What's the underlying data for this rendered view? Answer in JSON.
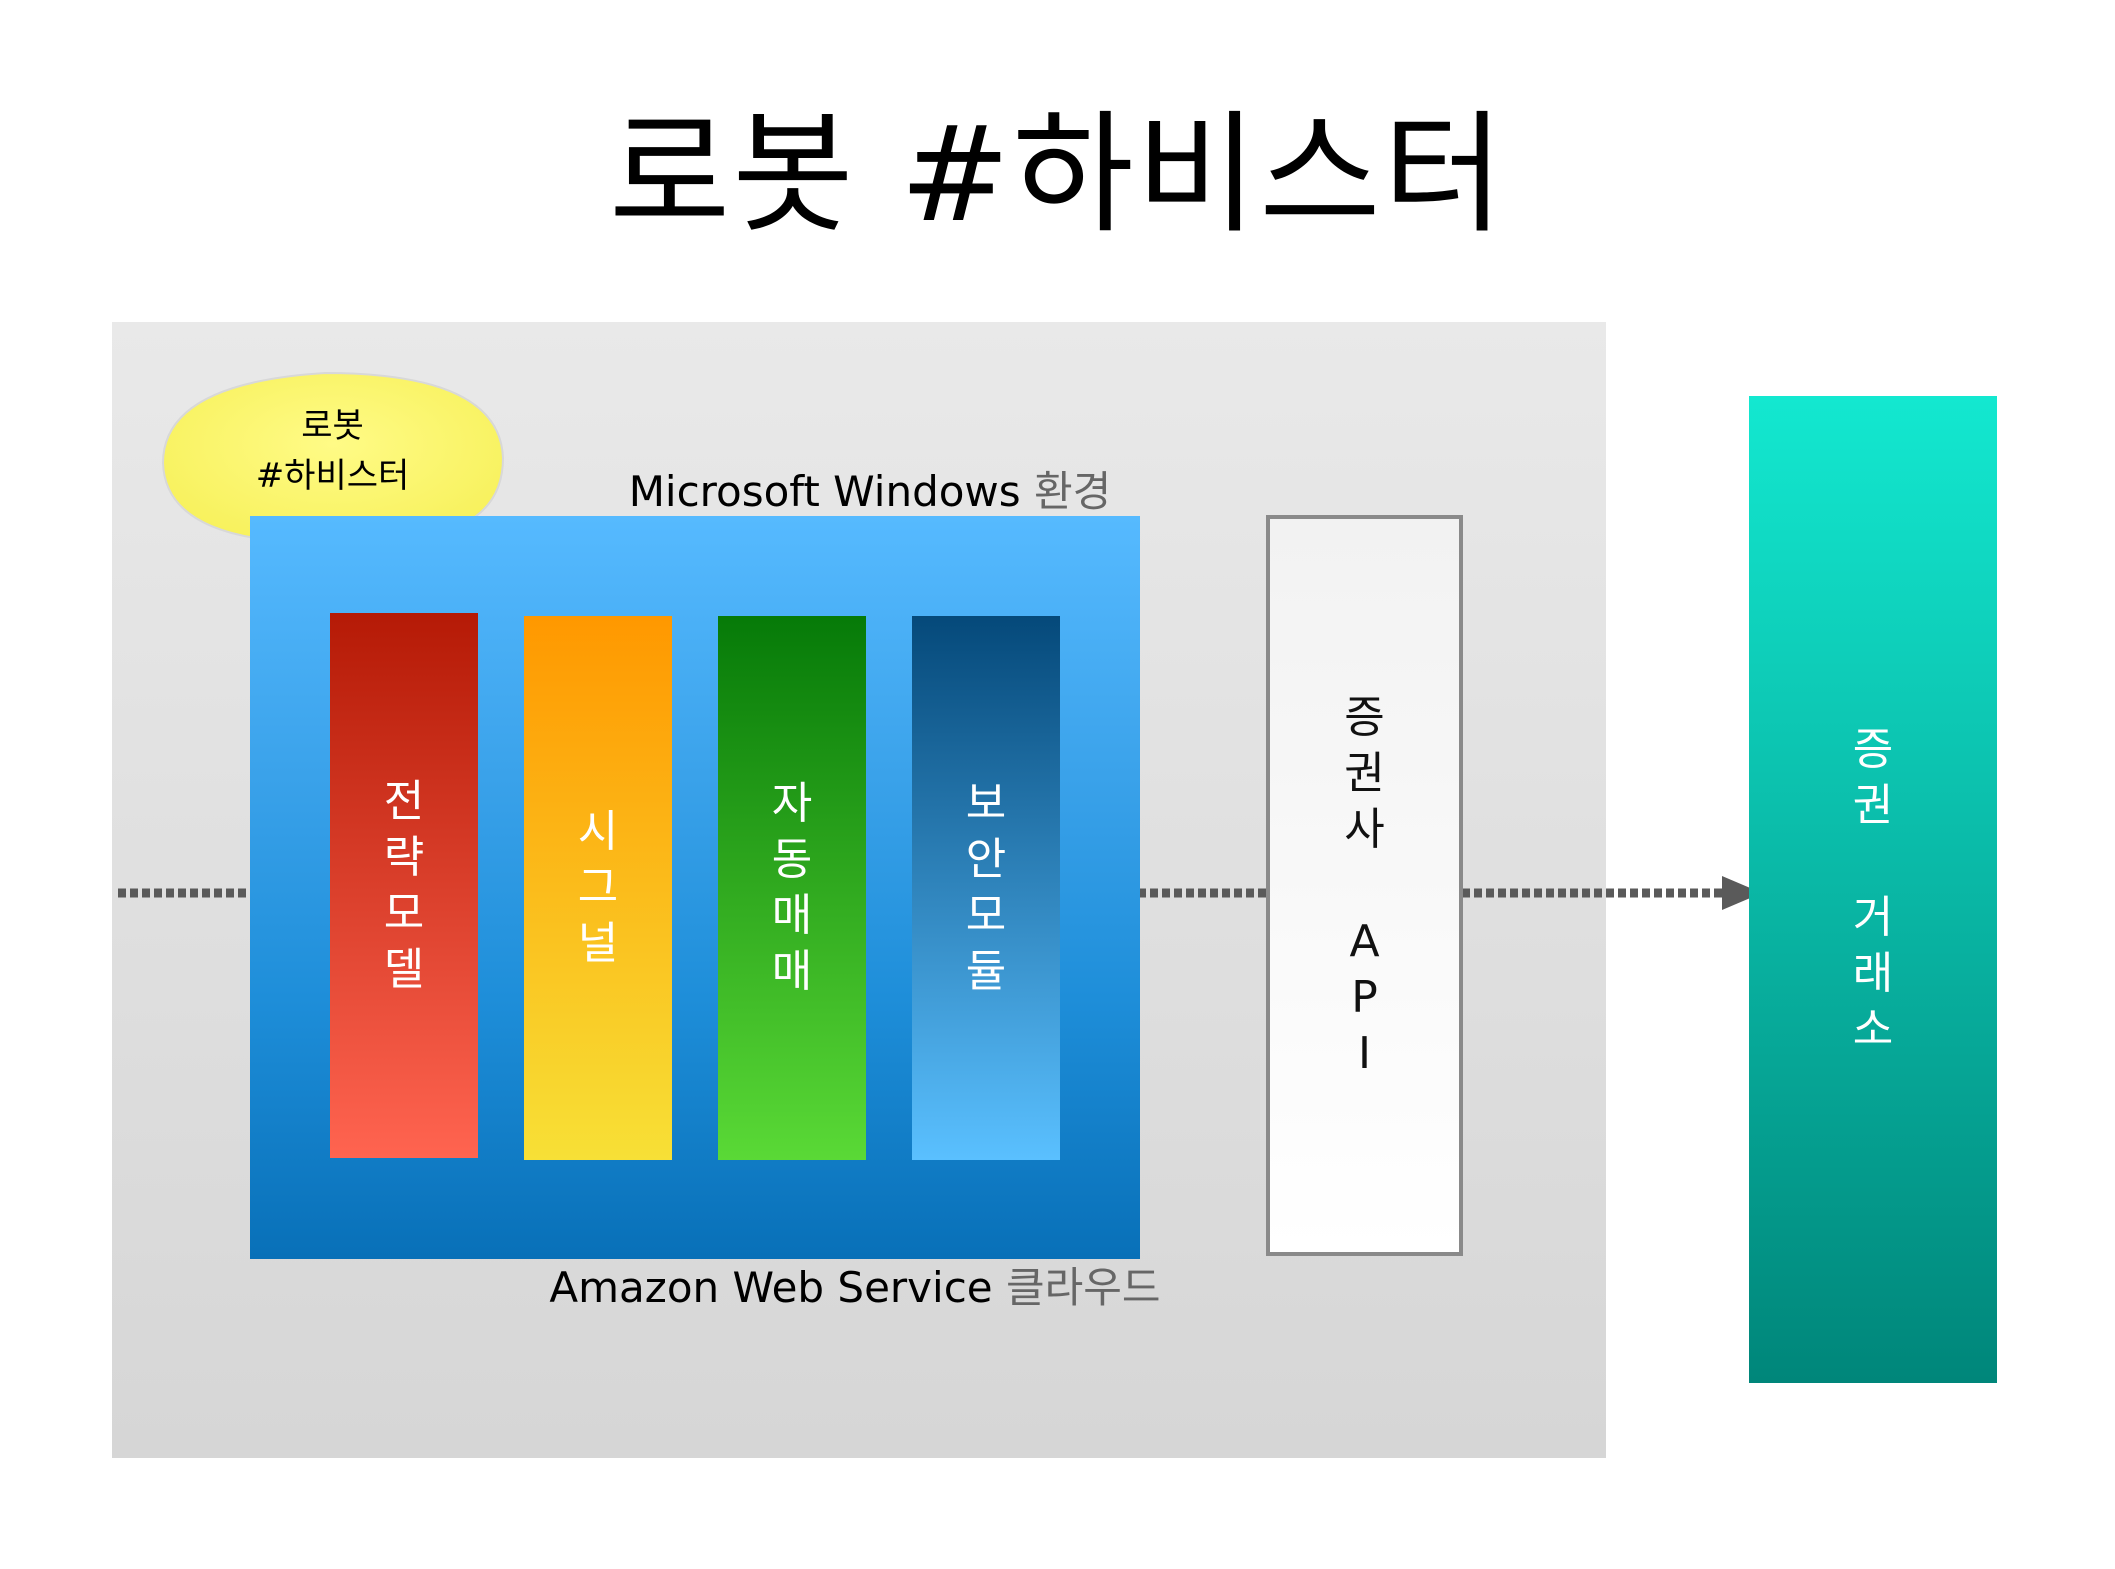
{
  "title": "로봇 #하비스터",
  "bubble": {
    "line1": "로봇",
    "line2": "#하비스터",
    "color": "#fdfa71"
  },
  "windows_label": {
    "en": "Microsoft Windows",
    "ko": "환경"
  },
  "aws_label": {
    "en": "Amazon Web Service",
    "ko": "클라우드"
  },
  "modules": [
    {
      "chars": [
        "전",
        "략",
        "모",
        "델"
      ],
      "color": "#d4331c"
    },
    {
      "chars": [
        "시",
        "그",
        "널"
      ],
      "color": "#fbbd1f"
    },
    {
      "chars": [
        "자",
        "동",
        "매",
        "매"
      ],
      "color": "#2aa21e"
    },
    {
      "chars": [
        "보",
        "안",
        "모",
        "듈"
      ],
      "color": "#2a7fbe"
    }
  ],
  "api": {
    "chars": [
      "증",
      "권",
      "사",
      "",
      "A",
      "P",
      "I"
    ]
  },
  "exchange": {
    "chars": [
      "증",
      "권",
      "",
      "거",
      "래",
      "소"
    ],
    "color": "#0bb9a8"
  },
  "connector_color": "#5a5a5a"
}
